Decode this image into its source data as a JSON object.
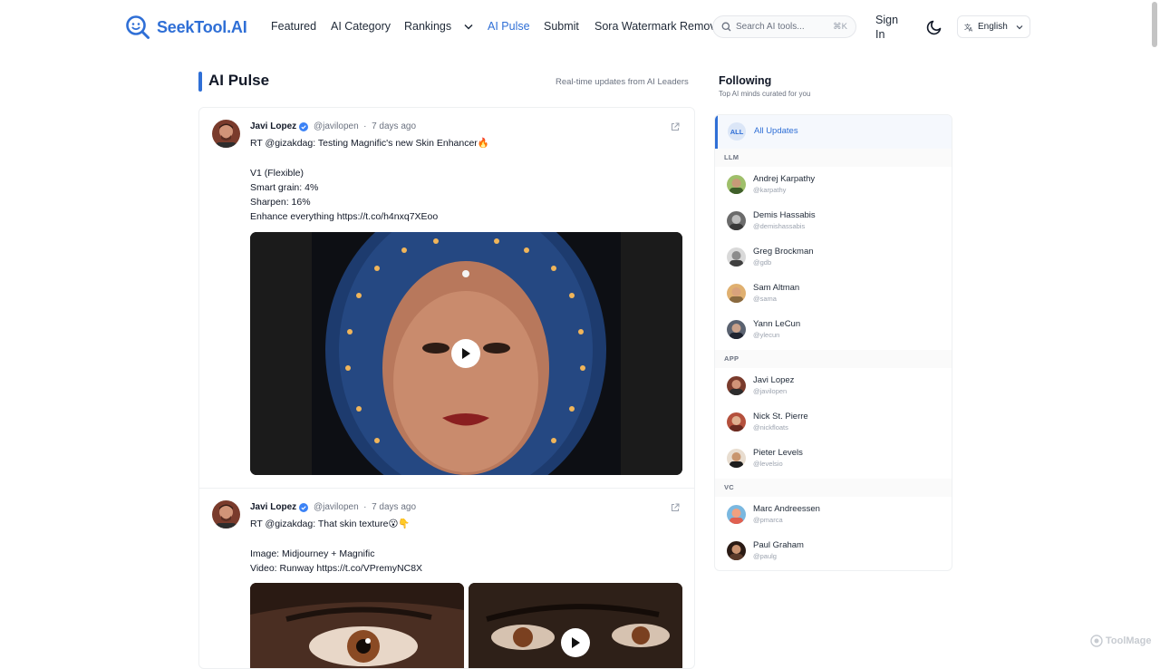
{
  "header": {
    "logo_text": "SeekTool.AI",
    "nav": [
      {
        "label": "Featured"
      },
      {
        "label": "AI Category"
      },
      {
        "label": "Rankings"
      },
      {
        "label": "AI Pulse"
      },
      {
        "label": "Submit"
      },
      {
        "label": "Sora Watermark Remover"
      }
    ],
    "search_placeholder": "Search AI tools...",
    "search_shortcut": "⌘K",
    "signin_label": "Sign In",
    "language": "English"
  },
  "page": {
    "title": "AI Pulse",
    "subtitle": "Real-time updates from AI Leaders"
  },
  "posts": [
    {
      "author": "Javi Lopez",
      "handle": "@javilopen",
      "time": "7 days ago",
      "lines": [
        "RT @gizakdag: Testing Magnific's new Skin Enhancer🔥",
        "",
        "V1 (Flexible)",
        "Smart grain: 4%",
        "Sharpen: 16%",
        "Enhance everything https://t.co/h4nxq7XEoo"
      ]
    },
    {
      "author": "Javi Lopez",
      "handle": "@javilopen",
      "time": "7 days ago",
      "lines": [
        "RT @gizakdag: That skin texture😮👇",
        "",
        "Image: Midjourney + Magnific",
        "Video: Runway https://t.co/VPremyNC8X"
      ]
    }
  ],
  "sidebar": {
    "title": "Following",
    "subtitle": "Top AI minds curated for you",
    "all_badge": "ALL",
    "all_label": "All Updates",
    "groups": [
      {
        "name": "LLM",
        "people": [
          {
            "name": "Andrej Karpathy",
            "handle": "@karpathy"
          },
          {
            "name": "Demis Hassabis",
            "handle": "@demishassabis"
          },
          {
            "name": "Greg Brockman",
            "handle": "@gdb"
          },
          {
            "name": "Sam Altman",
            "handle": "@sama"
          },
          {
            "name": "Yann LeCun",
            "handle": "@ylecun"
          }
        ]
      },
      {
        "name": "APP",
        "people": [
          {
            "name": "Javi Lopez",
            "handle": "@javilopen"
          },
          {
            "name": "Nick St. Pierre",
            "handle": "@nickfloats"
          },
          {
            "name": "Pieter Levels",
            "handle": "@levelsio"
          }
        ]
      },
      {
        "name": "VC",
        "people": [
          {
            "name": "Marc Andreessen",
            "handle": "@pmarca"
          },
          {
            "name": "Paul Graham",
            "handle": "@paulg"
          }
        ]
      }
    ]
  },
  "watermark": "ToolMage",
  "colors": {
    "accent": "#2f6fd6",
    "border": "#eef0f2"
  }
}
